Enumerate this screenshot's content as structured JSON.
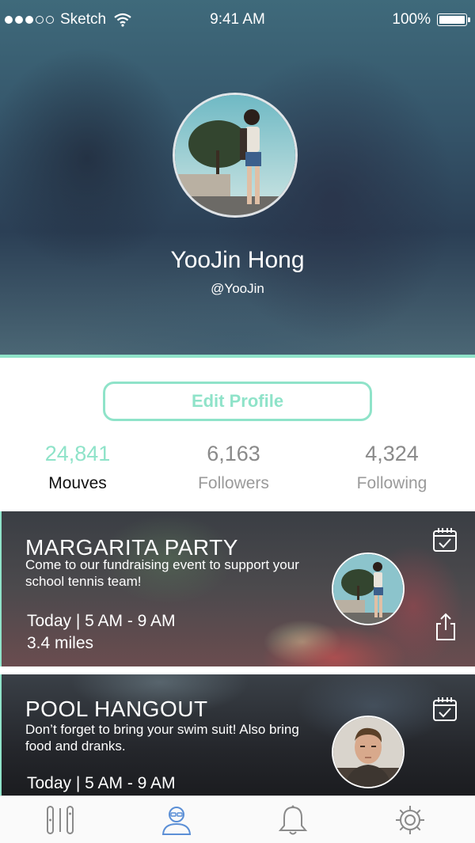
{
  "status_bar": {
    "carrier": "Sketch",
    "time": "9:41 AM",
    "battery": "100%"
  },
  "profile": {
    "name": "YooJin Hong",
    "handle": "@YooJin",
    "edit_button": "Edit Profile"
  },
  "stats": [
    {
      "value": "24,841",
      "label": "Mouves",
      "active": true
    },
    {
      "value": "6,163",
      "label": "Followers",
      "active": false
    },
    {
      "value": "4,324",
      "label": "Following",
      "active": false
    }
  ],
  "events": [
    {
      "title": "MARGARITA PARTY",
      "description": "Come to our fundraising event to support your school tennis team!",
      "time": "Today  | 5 AM - 9 AM",
      "distance": "3.4 miles"
    },
    {
      "title": "POOL HANGOUT",
      "description": "Don’t forget to bring your swim suit! Also bring food and dranks.",
      "time": "Today  | 5 AM - 9 AM"
    }
  ],
  "tab_bar": {
    "tabs": [
      {
        "icon": "feed-icon",
        "active": false
      },
      {
        "icon": "profile-icon",
        "active": true
      },
      {
        "icon": "bell-icon",
        "active": false
      },
      {
        "icon": "gear-icon",
        "active": false
      }
    ]
  },
  "colors": {
    "accent": "#8fe3c9",
    "active_tab": "#5b8fd6",
    "inactive_tab": "#8a8a8a"
  }
}
